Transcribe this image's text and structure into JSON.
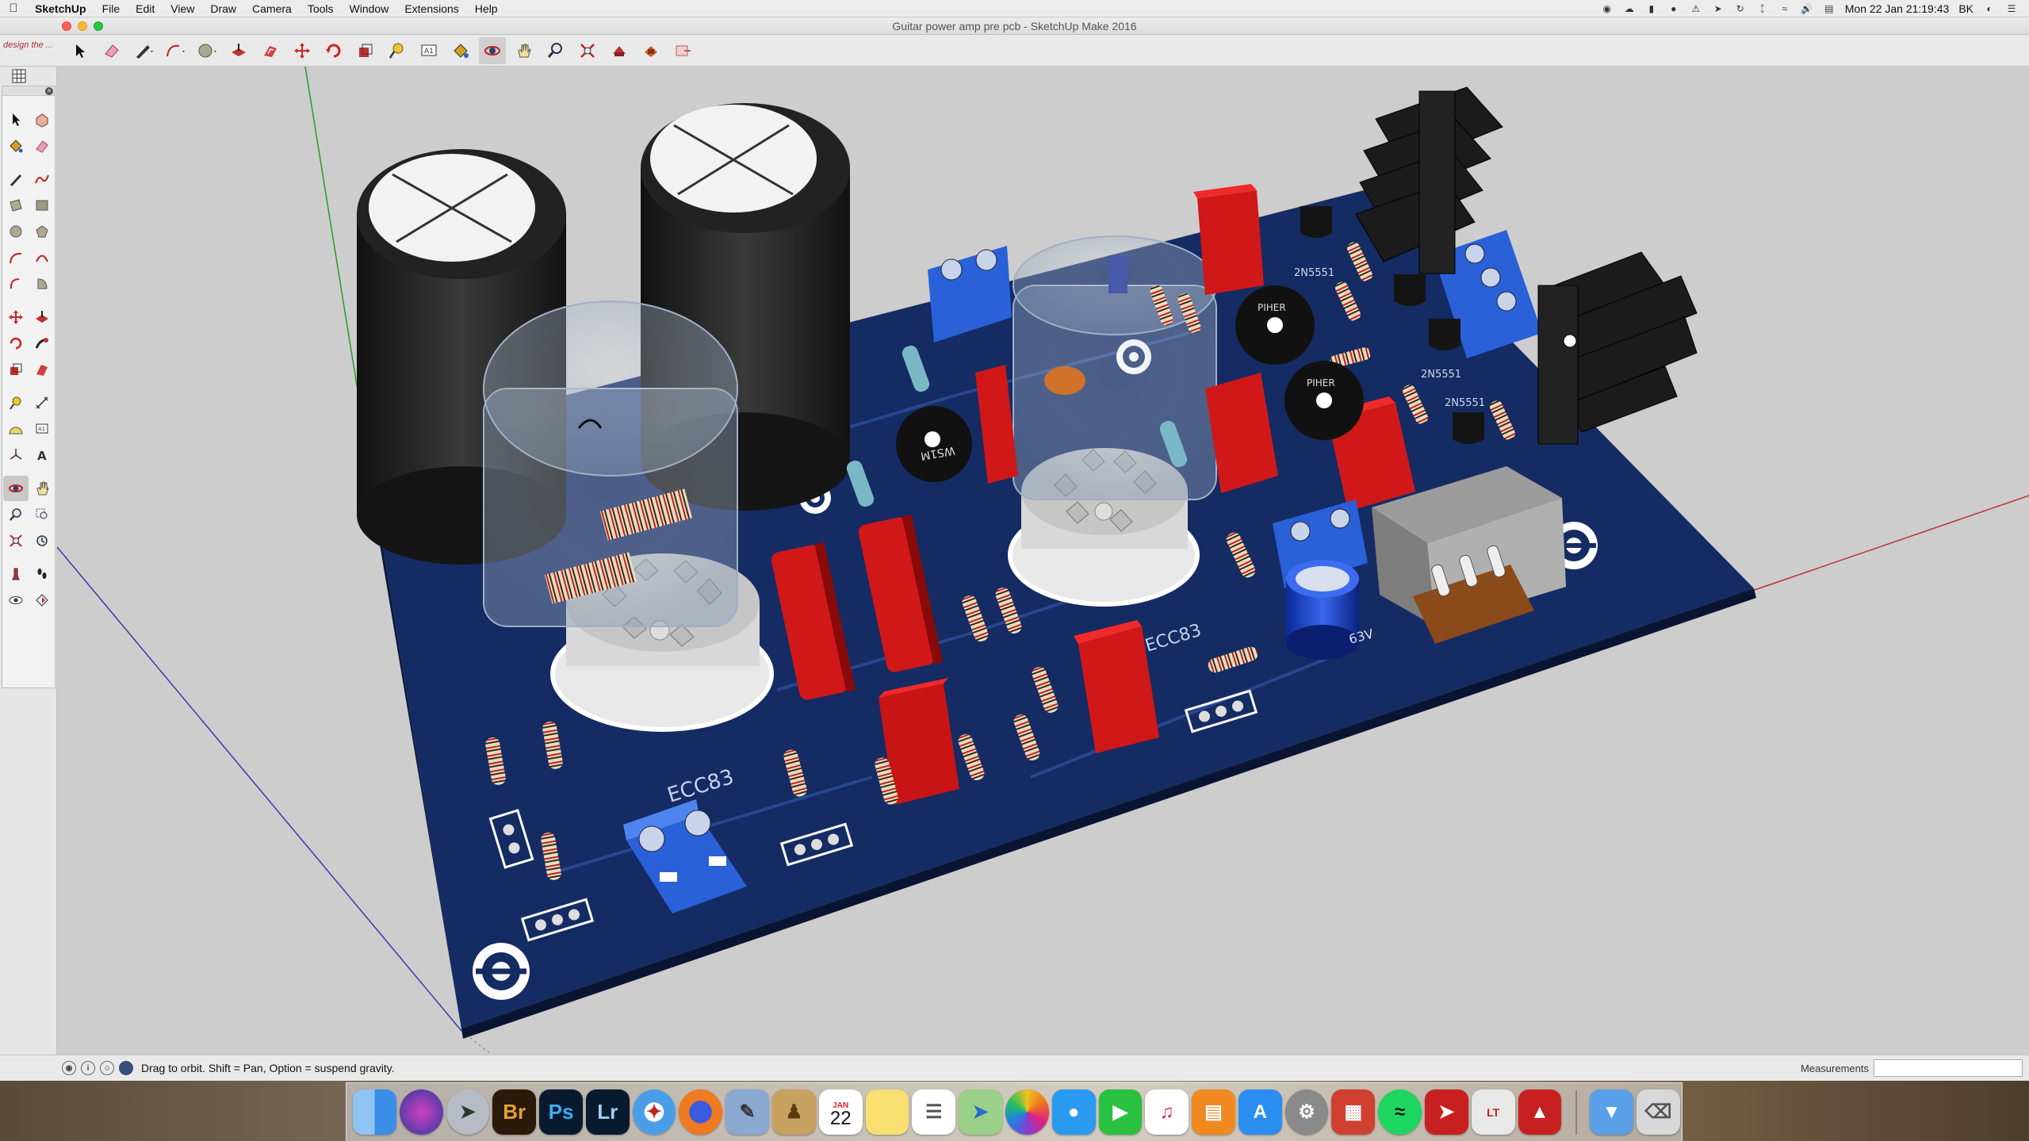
{
  "menubar": {
    "app_name": "SketchUp",
    "menus": [
      "File",
      "Edit",
      "View",
      "Draw",
      "Camera",
      "Tools",
      "Window",
      "Extensions",
      "Help"
    ],
    "clock": "Mon 22 Jan  21:19:43",
    "user": "BK"
  },
  "window": {
    "title": "Guitar power amp pre pcb - SketchUp Make 2016"
  },
  "toolbar": {
    "logo_text": "design the ..."
  },
  "status": {
    "hint": "Drag to orbit. Shift = Pan, Option = suspend gravity.",
    "measurements_label": "Measurements",
    "measurements_value": ""
  },
  "scene": {
    "tube_labels": [
      "ECC83",
      "ECC83"
    ],
    "transistor_labels": [
      "2N5551",
      "2N5551",
      "2N5551"
    ],
    "trimmer_labels": [
      "WS1M",
      "PIHER",
      "PIHER"
    ],
    "cap_label": "63V",
    "pcb_color": "#13285e"
  },
  "dock": {
    "calendar_month": "JAN",
    "calendar_day": "22"
  }
}
